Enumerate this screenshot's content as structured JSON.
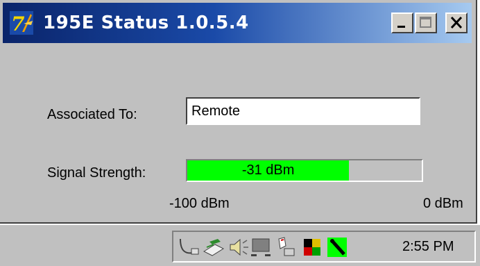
{
  "window": {
    "title": "195E Status 1.0.5.4",
    "icon": "app-logo-icon",
    "controls": {
      "minimize": "minimize-icon",
      "maximize": "maximize-icon",
      "close": "close-icon"
    }
  },
  "form": {
    "associated_label": "Associated To:",
    "associated_value": "Remote",
    "signal_label": "Signal Strength:",
    "signal_text": "-31 dBm",
    "signal_fraction": 0.69,
    "scale_min": "-100 dBm",
    "scale_max": "0 dBm"
  },
  "colors": {
    "titlebar_start": "#0a246a",
    "titlebar_end": "#a6caf0",
    "meter_fill": "#00ff00",
    "window_face": "#c0c0c0"
  },
  "taskbar": {
    "tray_icons": [
      "network-cable-icon",
      "usb-device-icon",
      "volume-icon",
      "display-icon",
      "mouse-icon",
      "color-flag-icon",
      "wireless-icon"
    ],
    "clock": "2:55 PM"
  }
}
